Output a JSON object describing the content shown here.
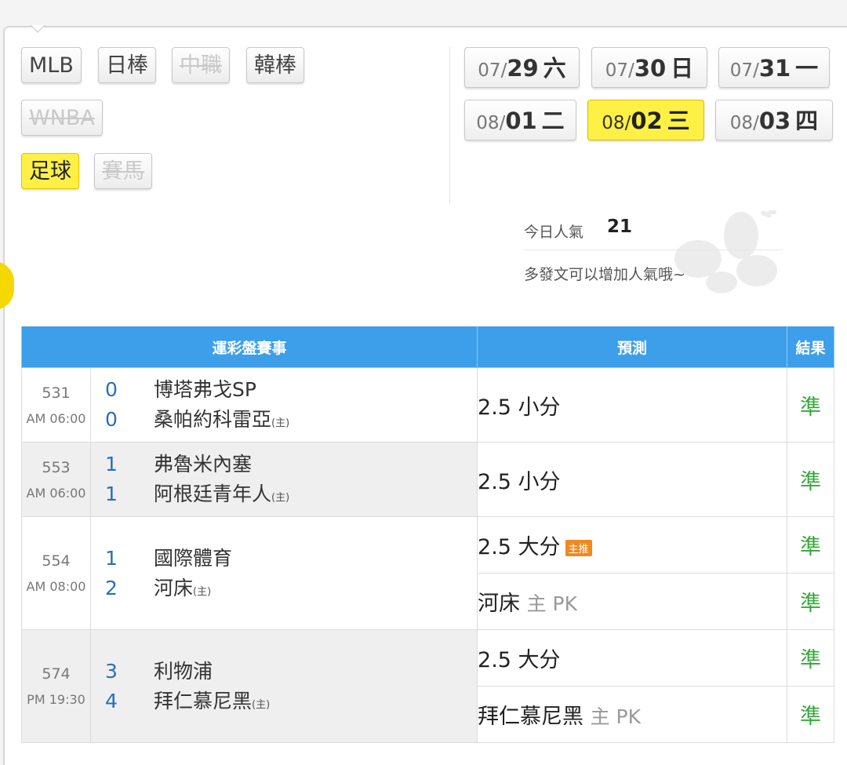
{
  "sports": [
    {
      "label": "MLB",
      "state": "normal"
    },
    {
      "label": "日棒",
      "state": "normal"
    },
    {
      "label": "中職",
      "state": "disabled"
    },
    {
      "label": "韓棒",
      "state": "normal"
    },
    {
      "label": "WNBA",
      "state": "disabled"
    },
    {
      "label": "足球",
      "state": "active"
    },
    {
      "label": "賽馬",
      "state": "disabled"
    }
  ],
  "dates": [
    {
      "month": "07/",
      "day": "29",
      "weekday": "六"
    },
    {
      "month": "07/",
      "day": "30",
      "weekday": "日"
    },
    {
      "month": "07/",
      "day": "31",
      "weekday": "一"
    },
    {
      "month": "08/",
      "day": "01",
      "weekday": "二"
    },
    {
      "month": "08/",
      "day": "02",
      "weekday": "三"
    },
    {
      "month": "08/",
      "day": "03",
      "weekday": "四"
    }
  ],
  "popularity": {
    "label": "今日人氣",
    "value": "21",
    "message": "多發文可以增加人氣哦~"
  },
  "table": {
    "headers": {
      "event": "運彩盤賽事",
      "prediction": "預測",
      "result": "結果"
    },
    "games": [
      {
        "no": "531",
        "time": "AM 06:00",
        "away": {
          "score": "0",
          "name": "博塔弗戈SP"
        },
        "home": {
          "score": "0",
          "name": "桑帕約科雷亞",
          "tag": "(主)"
        },
        "predictions": [
          {
            "main": "2.5 小分",
            "extra": "",
            "badge": "",
            "result": "準"
          }
        ]
      },
      {
        "no": "553",
        "time": "AM 06:00",
        "away": {
          "score": "1",
          "name": "弗魯米內塞"
        },
        "home": {
          "score": "1",
          "name": "阿根廷青年人",
          "tag": "(主)"
        },
        "predictions": [
          {
            "main": "2.5 小分",
            "extra": "",
            "badge": "",
            "result": "準"
          }
        ]
      },
      {
        "no": "554",
        "time": "AM 08:00",
        "away": {
          "score": "1",
          "name": "國際體育"
        },
        "home": {
          "score": "2",
          "name": "河床",
          "tag": "(主)"
        },
        "predictions": [
          {
            "main": "2.5 大分",
            "extra": "",
            "badge": "主推",
            "result": "準"
          },
          {
            "main": "河床",
            "extra": "主 PK",
            "badge": "",
            "result": "準"
          }
        ]
      },
      {
        "no": "574",
        "time": "PM 19:30",
        "away": {
          "score": "3",
          "name": "利物浦"
        },
        "home": {
          "score": "4",
          "name": "拜仁慕尼黑",
          "tag": "(主)"
        },
        "predictions": [
          {
            "main": "2.5 大分",
            "extra": "",
            "badge": "",
            "result": "準"
          },
          {
            "main": "拜仁慕尼黑",
            "extra": "主 PK",
            "badge": "",
            "result": "準"
          }
        ]
      }
    ]
  },
  "colors": {
    "accent": "#fff045",
    "header": "#3d9fea",
    "score": "#2a6fb5",
    "result": "#35a83a",
    "badge": "#ef8a1f"
  }
}
